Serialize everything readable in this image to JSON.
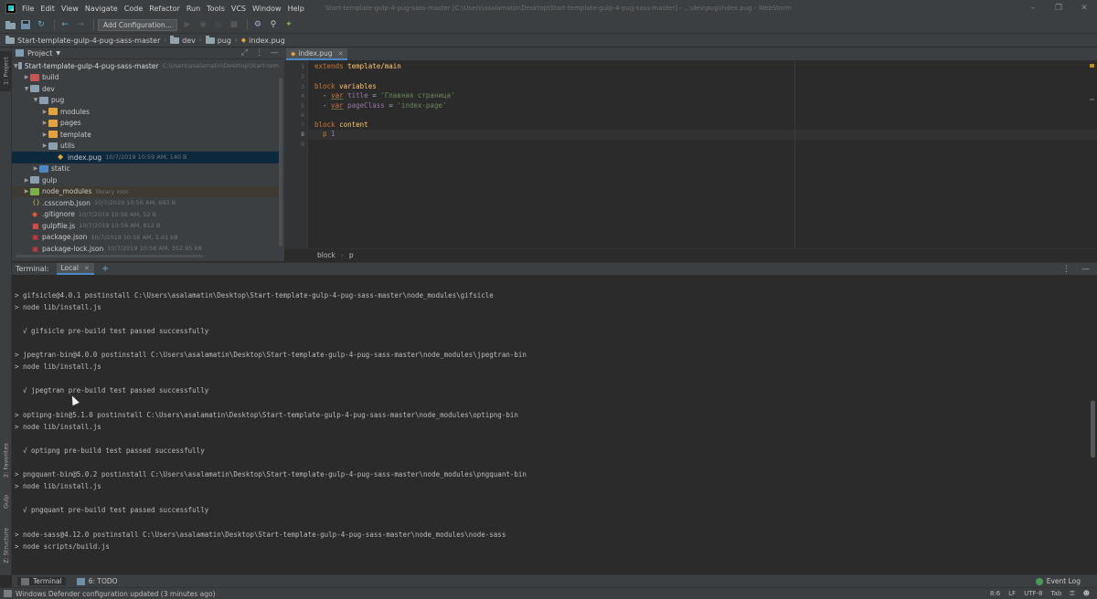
{
  "menubar": {
    "items": [
      "File",
      "Edit",
      "View",
      "Navigate",
      "Code",
      "Refactor",
      "Run",
      "Tools",
      "VCS",
      "Window",
      "Help"
    ],
    "window_title": "Start-template-gulp-4-pug-sass-master [C:\\Users\\asalamatin\\Desktop\\Start-template-gulp-4-pug-sass-master] - ...\\dev\\pug\\index.pug - WebStorm"
  },
  "toolbar": {
    "add_config_label": "Add Configuration..."
  },
  "navbar": {
    "crumbs": [
      "Start-template-gulp-4-pug-sass-master",
      "dev",
      "pug",
      "index.pug"
    ]
  },
  "left_stripe": {
    "project": "1: Project",
    "favorites": "2: Favorites",
    "gulp": "Gulp",
    "structure": "Z: Structure"
  },
  "project_panel": {
    "title": "Project",
    "root_name": "Start-template-gulp-4-pug-sass-master",
    "root_path": "C:\\Users\\asalamatin\\Desktop\\Start-tem",
    "items": [
      {
        "name": "build",
        "meta": ""
      },
      {
        "name": "dev",
        "meta": ""
      },
      {
        "name": "pug",
        "meta": ""
      },
      {
        "name": "modules",
        "meta": ""
      },
      {
        "name": "pages",
        "meta": ""
      },
      {
        "name": "template",
        "meta": ""
      },
      {
        "name": "utils",
        "meta": ""
      },
      {
        "name": "index.pug",
        "meta": "10/7/2019 10:59 AM, 140 B"
      },
      {
        "name": "static",
        "meta": ""
      },
      {
        "name": "gulp",
        "meta": ""
      },
      {
        "name": "node_modules",
        "meta": "library root"
      },
      {
        "name": ".csscomb.json",
        "meta": "10/7/2019 10:56 AM, 693 B"
      },
      {
        "name": ".gitignore",
        "meta": "10/7/2019 10:56 AM, 52 B"
      },
      {
        "name": "gulpfile.js",
        "meta": "10/7/2019 10:56 AM, 812 B"
      },
      {
        "name": "package.json",
        "meta": "10/7/2019 10:56 AM, 1.01 kB"
      },
      {
        "name": "package-lock.json",
        "meta": "10/7/2019 10:58 AM, 352.95 kB"
      }
    ]
  },
  "editor": {
    "tab_label": "index.pug",
    "line_numbers": [
      "1",
      "2",
      "3",
      "4",
      "5",
      "6",
      "7",
      "8",
      "9"
    ],
    "lines": [
      {
        "kw": "extends",
        "rest": " template/main"
      },
      {
        "kw": "",
        "rest": ""
      },
      {
        "kw": "block",
        "rest": " variables"
      },
      {
        "kw": "var",
        "prefix": "  - ",
        "name": " title",
        "eq": " = ",
        "str": "'Главная страница'"
      },
      {
        "kw": "var",
        "prefix": "  - ",
        "name": " pageClass",
        "eq": " = ",
        "str": "'index-page'"
      },
      {
        "kw": "",
        "rest": ""
      },
      {
        "kw": "block",
        "rest": " content"
      },
      {
        "kw": "p",
        "prefix": "  ",
        "rest": " 1"
      },
      {
        "kw": "",
        "rest": ""
      }
    ],
    "breadcrumbs": [
      "block",
      "p"
    ]
  },
  "terminal": {
    "title": "Terminal:",
    "tab_label": "Local",
    "lines": [
      "> gifsicle@4.0.1 postinstall C:\\Users\\asalamatin\\Desktop\\Start-template-gulp-4-pug-sass-master\\node_modules\\gifsicle",
      "> node lib/install.js",
      "",
      "  √ gifsicle pre-build test passed successfully",
      "",
      "> jpegtran-bin@4.0.0 postinstall C:\\Users\\asalamatin\\Desktop\\Start-template-gulp-4-pug-sass-master\\node_modules\\jpegtran-bin",
      "> node lib/install.js",
      "",
      "  √ jpegtran pre-build test passed successfully",
      "",
      "> optipng-bin@5.1.0 postinstall C:\\Users\\asalamatin\\Desktop\\Start-template-gulp-4-pug-sass-master\\node_modules\\optipng-bin",
      "> node lib/install.js",
      "",
      "  √ optipng pre-build test passed successfully",
      "",
      "> pngquant-bin@5.0.2 postinstall C:\\Users\\asalamatin\\Desktop\\Start-template-gulp-4-pug-sass-master\\node_modules\\pngquant-bin",
      "> node lib/install.js",
      "",
      "  √ pngquant pre-build test passed successfully",
      "",
      "> node-sass@4.12.0 postinstall C:\\Users\\asalamatin\\Desktop\\Start-template-gulp-4-pug-sass-master\\node_modules\\node-sass",
      "> node scripts/build.js"
    ]
  },
  "bottom_tools": {
    "terminal": "Terminal",
    "todo": "6: TODO",
    "event_log": "Event Log"
  },
  "statusbar": {
    "message": "Windows Defender configuration updated (3 minutes ago)",
    "position": "8:6",
    "line_sep": "LF",
    "encoding": "UTF-8",
    "indent": "Tab"
  }
}
